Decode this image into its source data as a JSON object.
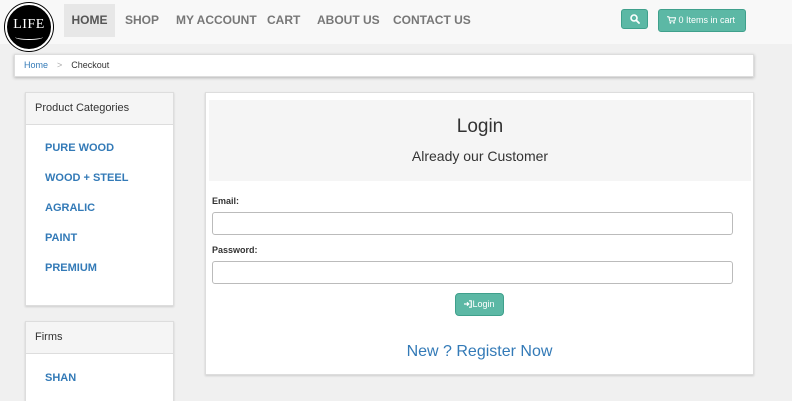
{
  "logo": {
    "text": "LIFE"
  },
  "nav": {
    "home": "HOME",
    "shop": "SHOP",
    "account": "MY ACCOUNT",
    "cart": "CART",
    "about": "ABOUT US",
    "contact": "CONTACT US"
  },
  "header": {
    "search_icon": "search-icon",
    "cart_icon": "shopping-cart-icon",
    "cart_label": "0 Items in cart"
  },
  "breadcrumb": {
    "home": "Home",
    "separator": ">",
    "current": "Checkout"
  },
  "categories": {
    "title": "Product Categories",
    "items": [
      "PURE WOOD",
      "WOOD + STEEL",
      "AGRALIC",
      "PAINT",
      "PREMIUM"
    ]
  },
  "firms": {
    "title": "Firms",
    "items": [
      "SHAN"
    ]
  },
  "login": {
    "title": "Login",
    "subtitle": "Already our Customer",
    "email_label": "Email:",
    "email_value": "",
    "password_label": "Password:",
    "password_value": "",
    "button_label": "Login",
    "button_icon": "sign-in-icon",
    "register_link": "New ? Register Now"
  },
  "colors": {
    "accent": "#5cb8a5",
    "link": "#337ab7",
    "background": "#f0f0f0"
  }
}
